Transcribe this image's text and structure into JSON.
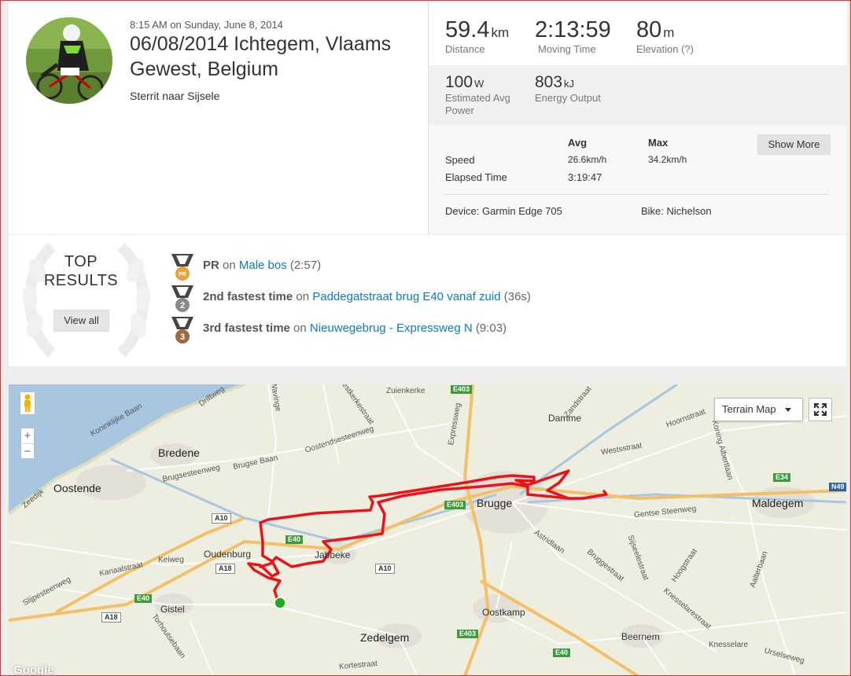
{
  "activity": {
    "datetime": "8:15 AM on Sunday, June 8, 2014",
    "title": "06/08/2014 Ichtegem, Vlaams Gewest, Belgium",
    "description": "Sterrit naar Sijsele"
  },
  "stats": {
    "distance": {
      "value": "59.4",
      "unit": "km",
      "label": "Distance"
    },
    "moving_time": {
      "value": "2:13:59",
      "label": "Moving Time"
    },
    "elevation": {
      "value": "80",
      "unit": "m",
      "label": "Elevation (?)"
    },
    "power": {
      "value": "100",
      "unit": "W",
      "label": "Estimated Avg Power"
    },
    "energy": {
      "value": "803",
      "unit": "kJ",
      "label": "Energy Output"
    }
  },
  "details": {
    "col_avg": "Avg",
    "col_max": "Max",
    "show_more": "Show More",
    "rows": [
      {
        "label": "Speed",
        "avg": "26.6km/h",
        "max": "34.2km/h"
      },
      {
        "label": "Elapsed Time",
        "avg": "3:19:47",
        "max": ""
      }
    ],
    "device": "Device: Garmin Edge 705",
    "bike": "Bike: Nichelson"
  },
  "top_results": {
    "title_line1": "TOP",
    "title_line2": "RESULTS",
    "view_all": "View all",
    "items": [
      {
        "medal": "PR",
        "rank": "PR",
        "on": "on",
        "segment": "Male bos",
        "time": "(2:57)",
        "color": "#e8a23a"
      },
      {
        "medal": "2",
        "rank": "2nd fastest time",
        "on": "on",
        "segment": "Paddegatstraat brug E40 vanaf zuid",
        "time": "(36s)",
        "color": "#8a8a8a"
      },
      {
        "medal": "3",
        "rank": "3rd fastest time",
        "on": "on",
        "segment": "Nieuwegebrug - Expressweg N",
        "time": "(9:03)",
        "color": "#9b6b43"
      }
    ]
  },
  "map": {
    "type_button": "Terrain Map",
    "zoom_in": "+",
    "zoom_out": "−",
    "route_color": "#e8141a",
    "start_color": "#22aa22",
    "cities": {
      "oostende": "Oostende",
      "bredene": "Bredene",
      "brugge": "Brugge",
      "jabbeke": "Jabbeke",
      "oudenburg": "Oudenburg",
      "gistel": "Gistel",
      "zedelgem": "Zedelgem",
      "oostkamp": "Oostkamp",
      "beernem": "Beernem",
      "damme": "Damme",
      "maldegem": "Maldegem",
      "knesselare": "Knesselare",
      "zuienkerke": "Zuienkerke"
    },
    "roads": {
      "r1": "Koninklijke Baan",
      "r2": "Driftweg",
      "r3": "Zeedijk",
      "r4": "Brugsesteenweg",
      "r5": "Brugse Baan",
      "r6": "Oostendsesteenweg",
      "r7": "Kanaalstraat",
      "r8": "Keiweg",
      "r9": "Slijpesteenweg",
      "r10": "Torhoutsebaan",
      "r11": "Expressweg",
      "r12": "Westkerkestraat",
      "r13": "Zandstraat",
      "r14": "Gentse Steenweg",
      "r15": "Westsstraat",
      "r16": "Hoornstraat",
      "r17": "Koning Albertlaan",
      "r18": "Astridlaan",
      "r19": "Bruggestraat",
      "r20": "Sijseelestraat",
      "r21": "Hoogstraat",
      "r22": "Knesselarestraat",
      "r23": "Aalterbaan",
      "r24": "Urselseweg",
      "r25": "Wavinge",
      "r26": "Kortestraat"
    },
    "shields": {
      "e403a": "E403",
      "e403b": "E403",
      "e403c": "E403",
      "e40a": "E40",
      "e40b": "E40",
      "e40c": "E40",
      "a10a": "A10",
      "a10b": "A10",
      "a18a": "A18",
      "a18b": "A18",
      "e34": "E34",
      "n49": "N49"
    },
    "attribution": "Google"
  }
}
